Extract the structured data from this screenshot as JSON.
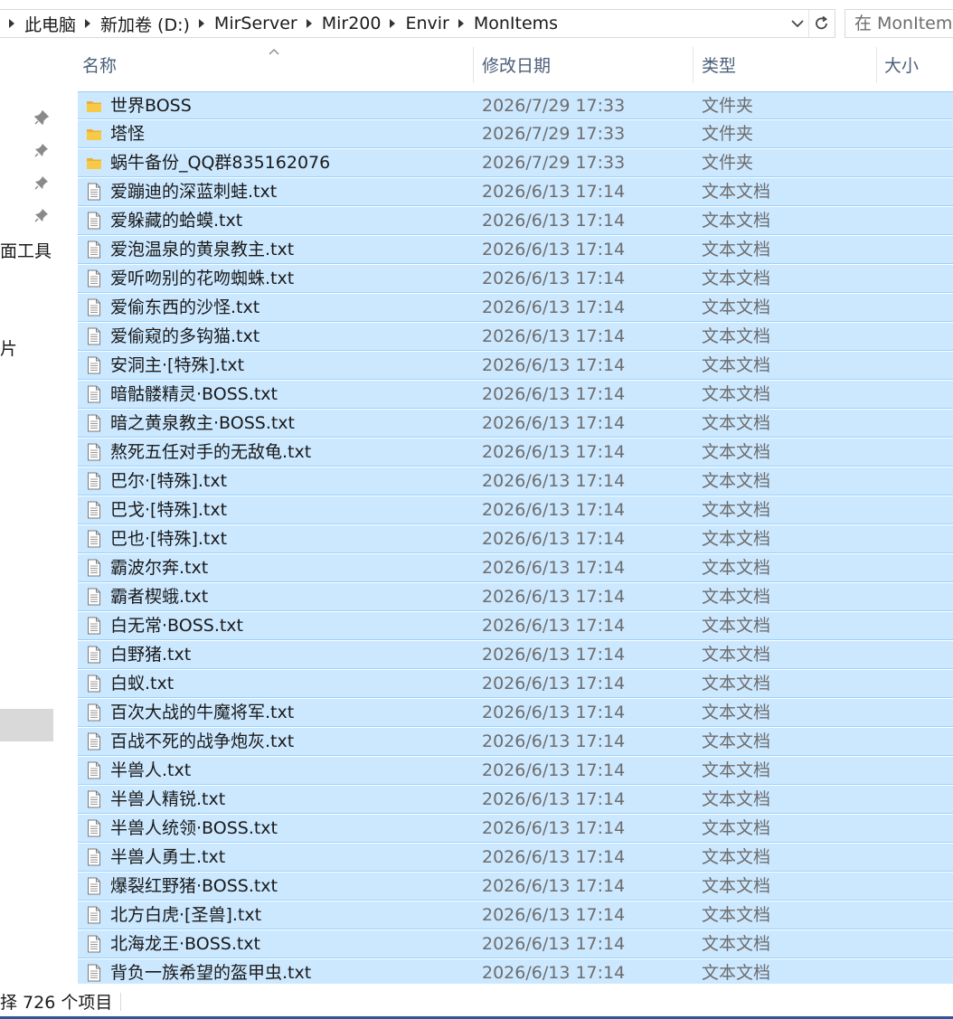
{
  "address": {
    "crumbs": [
      "此电脑",
      "新加卷 (D:)",
      "MirServer",
      "Mir200",
      "Envir",
      "MonItems"
    ]
  },
  "search": {
    "placeholder": "在 MonItems"
  },
  "nav": {
    "partial_labels": [
      "面工具",
      "片"
    ]
  },
  "columns": {
    "name": "名称",
    "date": "修改日期",
    "type": "类型",
    "size": "大小"
  },
  "files": [
    {
      "icon": "folder",
      "name": "世界BOSS",
      "date": "2026/7/29 17:33",
      "type": "文件夹"
    },
    {
      "icon": "folder",
      "name": "塔怪",
      "date": "2026/7/29 17:33",
      "type": "文件夹"
    },
    {
      "icon": "folder",
      "name": "蜗牛备份_QQ群835162076",
      "date": "2026/7/29 17:33",
      "type": "文件夹"
    },
    {
      "icon": "text",
      "name": "爱蹦迪的深蓝刺蛙.txt",
      "date": "2026/6/13 17:14",
      "type": "文本文档"
    },
    {
      "icon": "text",
      "name": "爱躲藏的蛤蟆.txt",
      "date": "2026/6/13 17:14",
      "type": "文本文档"
    },
    {
      "icon": "text",
      "name": "爱泡温泉的黄泉教主.txt",
      "date": "2026/6/13 17:14",
      "type": "文本文档"
    },
    {
      "icon": "text",
      "name": "爱听吻别的花吻蜘蛛.txt",
      "date": "2026/6/13 17:14",
      "type": "文本文档"
    },
    {
      "icon": "text",
      "name": "爱偷东西的沙怪.txt",
      "date": "2026/6/13 17:14",
      "type": "文本文档"
    },
    {
      "icon": "text",
      "name": "爱偷窥的多钩猫.txt",
      "date": "2026/6/13 17:14",
      "type": "文本文档"
    },
    {
      "icon": "text",
      "name": "安洞主·[特殊].txt",
      "date": "2026/6/13 17:14",
      "type": "文本文档"
    },
    {
      "icon": "text",
      "name": "暗骷髅精灵·BOSS.txt",
      "date": "2026/6/13 17:14",
      "type": "文本文档"
    },
    {
      "icon": "text",
      "name": "暗之黄泉教主·BOSS.txt",
      "date": "2026/6/13 17:14",
      "type": "文本文档"
    },
    {
      "icon": "text",
      "name": "熬死五任对手的无敌龟.txt",
      "date": "2026/6/13 17:14",
      "type": "文本文档"
    },
    {
      "icon": "text",
      "name": "巴尔·[特殊].txt",
      "date": "2026/6/13 17:14",
      "type": "文本文档"
    },
    {
      "icon": "text",
      "name": "巴戈·[特殊].txt",
      "date": "2026/6/13 17:14",
      "type": "文本文档"
    },
    {
      "icon": "text",
      "name": "巴也·[特殊].txt",
      "date": "2026/6/13 17:14",
      "type": "文本文档"
    },
    {
      "icon": "text",
      "name": "霸波尔奔.txt",
      "date": "2026/6/13 17:14",
      "type": "文本文档"
    },
    {
      "icon": "text",
      "name": "霸者楔蛾.txt",
      "date": "2026/6/13 17:14",
      "type": "文本文档"
    },
    {
      "icon": "text",
      "name": "白无常·BOSS.txt",
      "date": "2026/6/13 17:14",
      "type": "文本文档"
    },
    {
      "icon": "text",
      "name": "白野猪.txt",
      "date": "2026/6/13 17:14",
      "type": "文本文档"
    },
    {
      "icon": "text",
      "name": "白蚁.txt",
      "date": "2026/6/13 17:14",
      "type": "文本文档"
    },
    {
      "icon": "text",
      "name": "百次大战的牛魔将军.txt",
      "date": "2026/6/13 17:14",
      "type": "文本文档"
    },
    {
      "icon": "text",
      "name": "百战不死的战争炮灰.txt",
      "date": "2026/6/13 17:14",
      "type": "文本文档"
    },
    {
      "icon": "text",
      "name": "半兽人.txt",
      "date": "2026/6/13 17:14",
      "type": "文本文档"
    },
    {
      "icon": "text",
      "name": "半兽人精锐.txt",
      "date": "2026/6/13 17:14",
      "type": "文本文档"
    },
    {
      "icon": "text",
      "name": "半兽人统领·BOSS.txt",
      "date": "2026/6/13 17:14",
      "type": "文本文档"
    },
    {
      "icon": "text",
      "name": "半兽人勇士.txt",
      "date": "2026/6/13 17:14",
      "type": "文本文档"
    },
    {
      "icon": "text",
      "name": "爆裂红野猪·BOSS.txt",
      "date": "2026/6/13 17:14",
      "type": "文本文档"
    },
    {
      "icon": "text",
      "name": "北方白虎·[圣兽].txt",
      "date": "2026/6/13 17:14",
      "type": "文本文档"
    },
    {
      "icon": "text",
      "name": "北海龙王·BOSS.txt",
      "date": "2026/6/13 17:14",
      "type": "文本文档"
    },
    {
      "icon": "text",
      "name": "背负一族希望的盔甲虫.txt",
      "date": "2026/6/13 17:14",
      "type": "文本文档"
    }
  ],
  "status": {
    "text": "择 726 个项目"
  },
  "colors": {
    "selection": "#cce8ff",
    "selection_border": "#99d1ff",
    "header_text": "#4c607a",
    "folder": "#f8c945"
  }
}
